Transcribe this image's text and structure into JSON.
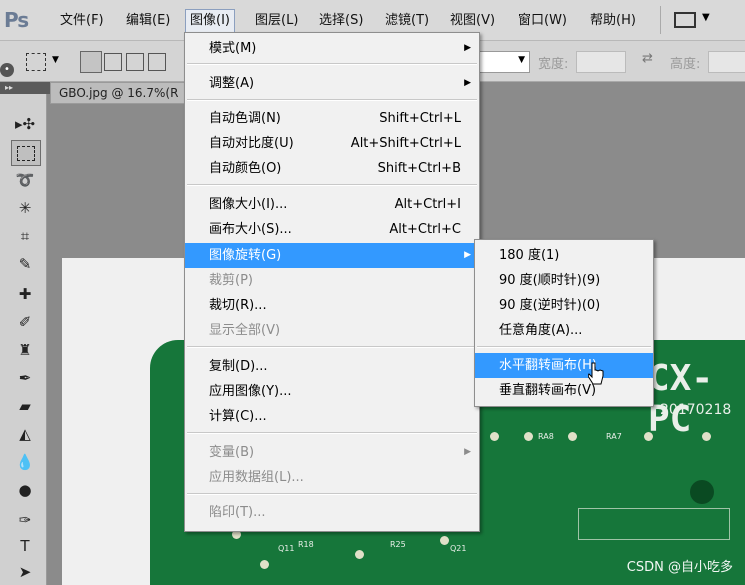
{
  "app": {
    "logo": "Ps"
  },
  "menubar": [
    {
      "label": "文件(F)"
    },
    {
      "label": "编辑(E)"
    },
    {
      "label": "图像(I)",
      "active": true
    },
    {
      "label": "图层(L)"
    },
    {
      "label": "选择(S)"
    },
    {
      "label": "滤镜(T)"
    },
    {
      "label": "视图(V)"
    },
    {
      "label": "窗口(W)"
    },
    {
      "label": "帮助(H)"
    }
  ],
  "options": {
    "width_label": "宽度:",
    "height_label": "高度:"
  },
  "document": {
    "tab_title": "GBO.jpg @ 16.7%(R"
  },
  "image_menu": {
    "items": [
      {
        "label": "模式(M)",
        "submenu": true
      },
      {
        "label": "调整(A)",
        "submenu": true
      },
      {
        "label": "自动色调(N)",
        "shortcut": "Shift+Ctrl+L"
      },
      {
        "label": "自动对比度(U)",
        "shortcut": "Alt+Shift+Ctrl+L"
      },
      {
        "label": "自动颜色(O)",
        "shortcut": "Shift+Ctrl+B"
      },
      {
        "label": "图像大小(I)...",
        "shortcut": "Alt+Ctrl+I"
      },
      {
        "label": "画布大小(S)...",
        "shortcut": "Alt+Ctrl+C"
      },
      {
        "label": "图像旋转(G)",
        "submenu": true,
        "highlighted": true
      },
      {
        "label": "裁剪(P)",
        "disabled": true
      },
      {
        "label": "裁切(R)..."
      },
      {
        "label": "显示全部(V)",
        "disabled": true
      },
      {
        "label": "复制(D)..."
      },
      {
        "label": "应用图像(Y)..."
      },
      {
        "label": "计算(C)..."
      },
      {
        "label": "变量(B)",
        "submenu": true,
        "disabled": true
      },
      {
        "label": "应用数据组(L)...",
        "disabled": true
      },
      {
        "label": "陷印(T)...",
        "disabled": true
      }
    ]
  },
  "rotate_submenu": {
    "items": [
      {
        "label": "180 度(1)"
      },
      {
        "label": "90 度(顺时针)(9)"
      },
      {
        "label": "90 度(逆时针)(0)"
      },
      {
        "label": "任意角度(A)..."
      },
      {
        "label": "水平翻转画布(H)",
        "highlighted": true
      },
      {
        "label": "垂直翻转画布(V)"
      }
    ]
  },
  "board": {
    "title": "CX-PC",
    "date": "20170218",
    "labels": [
      "RA8",
      "RA7",
      "R18",
      "R25",
      "Q11",
      "Q21"
    ]
  },
  "watermark": "CSDN @自小吃多",
  "colors": {
    "highlight": "#3399ff",
    "pcb": "#16763a"
  }
}
